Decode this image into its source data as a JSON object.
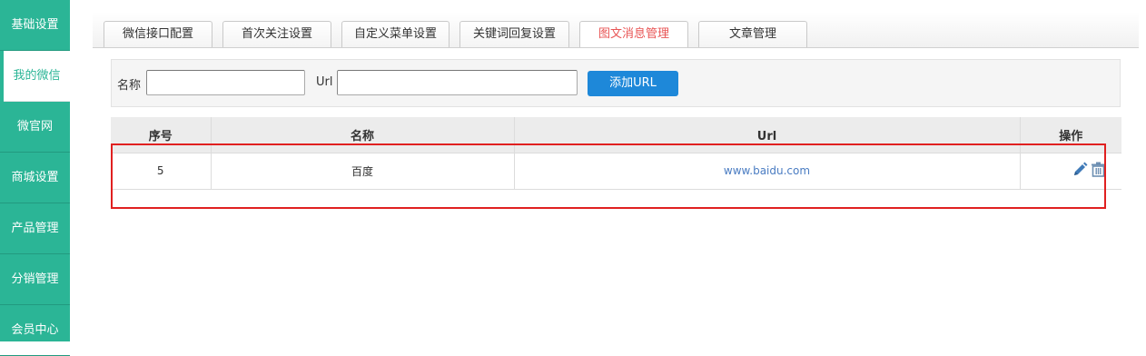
{
  "sidebar": {
    "items": [
      {
        "label": "基础设置"
      },
      {
        "label": "我的微信"
      },
      {
        "label": "微官网"
      },
      {
        "label": "商城设置"
      },
      {
        "label": "产品管理"
      },
      {
        "label": "分销管理"
      },
      {
        "label": "会员中心"
      }
    ]
  },
  "tabs": [
    {
      "label": "微信接口配置"
    },
    {
      "label": "首次关注设置"
    },
    {
      "label": "自定义菜单设置"
    },
    {
      "label": "关键词回复设置"
    },
    {
      "label": "图文消息管理"
    },
    {
      "label": "文章管理"
    }
  ],
  "form": {
    "name_label": "名称",
    "name_value": "",
    "url_label": "Url",
    "url_value": "",
    "add_button": "添加URL"
  },
  "table": {
    "headers": [
      "序号",
      "名称",
      "Url",
      "操作"
    ],
    "rows": [
      {
        "id": "5",
        "name": "百度",
        "url": "www.baidu.com"
      }
    ]
  },
  "colors": {
    "sidebar_bg": "#2bb596",
    "active_tab_text": "#e85454",
    "button_blue": "#1e88d9",
    "link_blue": "#4a7cc2",
    "highlight_red": "#e02020"
  }
}
